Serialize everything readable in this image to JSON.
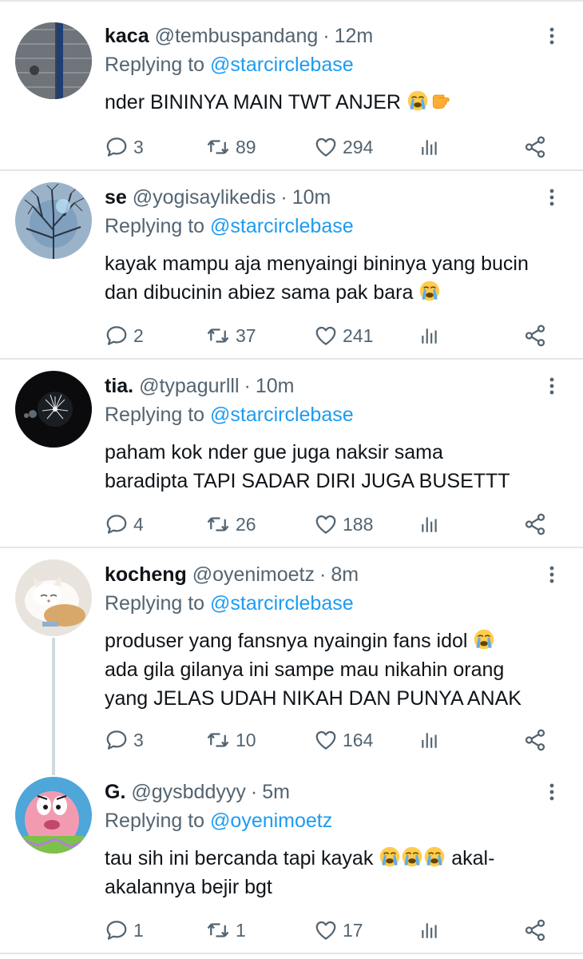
{
  "tweets": [
    {
      "name": "kaca",
      "handle": "@tembuspandang",
      "time": "12m",
      "replying_prefix": "Replying to",
      "replying_to": "@starcirclebase",
      "text_lines": [
        "nder BININYA MAIN TWT ANJER"
      ],
      "emojis": [
        "loudly-crying-face",
        "pointing-hand"
      ],
      "replies": "3",
      "retweets": "89",
      "likes": "294"
    },
    {
      "name": "se",
      "handle": "@yogisaylikedis",
      "time": "10m",
      "replying_prefix": "Replying to",
      "replying_to": "@starcirclebase",
      "text_lines": [
        "kayak mampu aja menyaingi bininya yang bucin",
        "dan dibucinin abiez sama pak bara"
      ],
      "emojis": [
        "loudly-crying-face"
      ],
      "replies": "2",
      "retweets": "37",
      "likes": "241"
    },
    {
      "name": "tia.",
      "handle": "@typagurlll",
      "time": "10m",
      "replying_prefix": "Replying to",
      "replying_to": "@starcirclebase",
      "text_lines": [
        "paham kok nder gue juga naksir sama",
        "baradipta TAPI SADAR DIRI JUGA BUSETTT"
      ],
      "emojis": [],
      "replies": "4",
      "retweets": "26",
      "likes": "188"
    },
    {
      "name": "kocheng",
      "handle": "@oyenimoetz",
      "time": "8m",
      "replying_prefix": "Replying to",
      "replying_to": "@starcirclebase",
      "text_lines": [
        "produser yang fansnya nyaingin fans idol",
        "ada gila gilanya ini sampe mau nikahin orang",
        "yang JELAS UDAH NIKAH DAN PUNYA ANAK"
      ],
      "emojis": [
        "loudly-crying-face"
      ],
      "replies": "3",
      "retweets": "10",
      "likes": "164"
    },
    {
      "name": "G.",
      "handle": "@gysbddyyy",
      "time": "5m",
      "replying_prefix": "Replying to",
      "replying_to": "@oyenimoetz",
      "text_lines": [
        "tau sih ini bercanda tapi kayak",
        "akal-",
        "akalannya bejir bgt"
      ],
      "emojis": [
        "loudly-crying-face",
        "loudly-crying-face",
        "loudly-crying-face"
      ],
      "replies": "1",
      "retweets": "1",
      "likes": "17"
    }
  ],
  "colors": {
    "text": "#0f1419",
    "secondary": "#536471",
    "link": "#1d9bf0",
    "divider": "#e3e6e8",
    "thread_line": "#cfd9de"
  },
  "icons": [
    "reply-icon",
    "retweet-icon",
    "like-icon",
    "views-icon",
    "share-icon",
    "more-icon"
  ]
}
